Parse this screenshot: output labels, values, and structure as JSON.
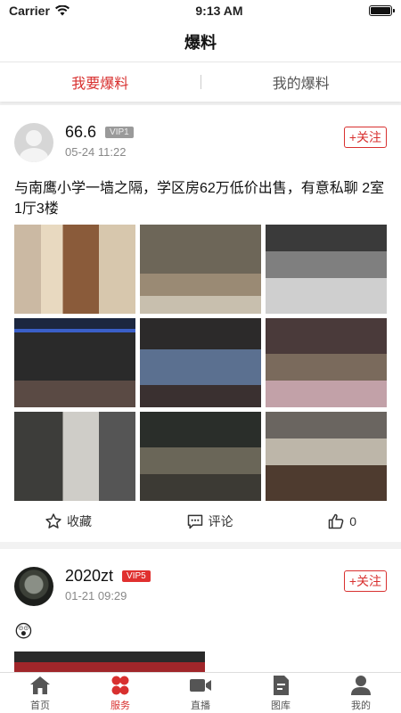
{
  "status_bar": {
    "carrier": "Carrier",
    "time": "9:13 AM"
  },
  "nav": {
    "title": "爆料"
  },
  "tabs": [
    {
      "label": "我要爆料",
      "active": true
    },
    {
      "label": "我的爆料",
      "active": false
    }
  ],
  "posts": [
    {
      "user_name": "66.6",
      "vip": "VIP1",
      "time": "05-24 11:22",
      "follow_label": "+关注",
      "text": "与南鹰小学一墙之隔，学区房62万低价出售，有意私聊  2室1厅3楼",
      "actions": {
        "collect": "收藏",
        "comment": "评论",
        "likes": "0"
      }
    },
    {
      "user_name": "2020zt",
      "vip": "VIP5",
      "time": "01-21 09:29",
      "follow_label": "+关注",
      "emoji": "😲"
    }
  ],
  "tab_bar": [
    {
      "label": "首页",
      "icon": "home-icon"
    },
    {
      "label": "服务",
      "icon": "service-icon",
      "active": true
    },
    {
      "label": "直播",
      "icon": "video-icon"
    },
    {
      "label": "图库",
      "icon": "gallery-icon"
    },
    {
      "label": "我的",
      "icon": "user-icon"
    }
  ],
  "colors": {
    "accent": "#d8302f",
    "vip_gray": "#9a9a9a",
    "vip_red": "#e0302f"
  }
}
